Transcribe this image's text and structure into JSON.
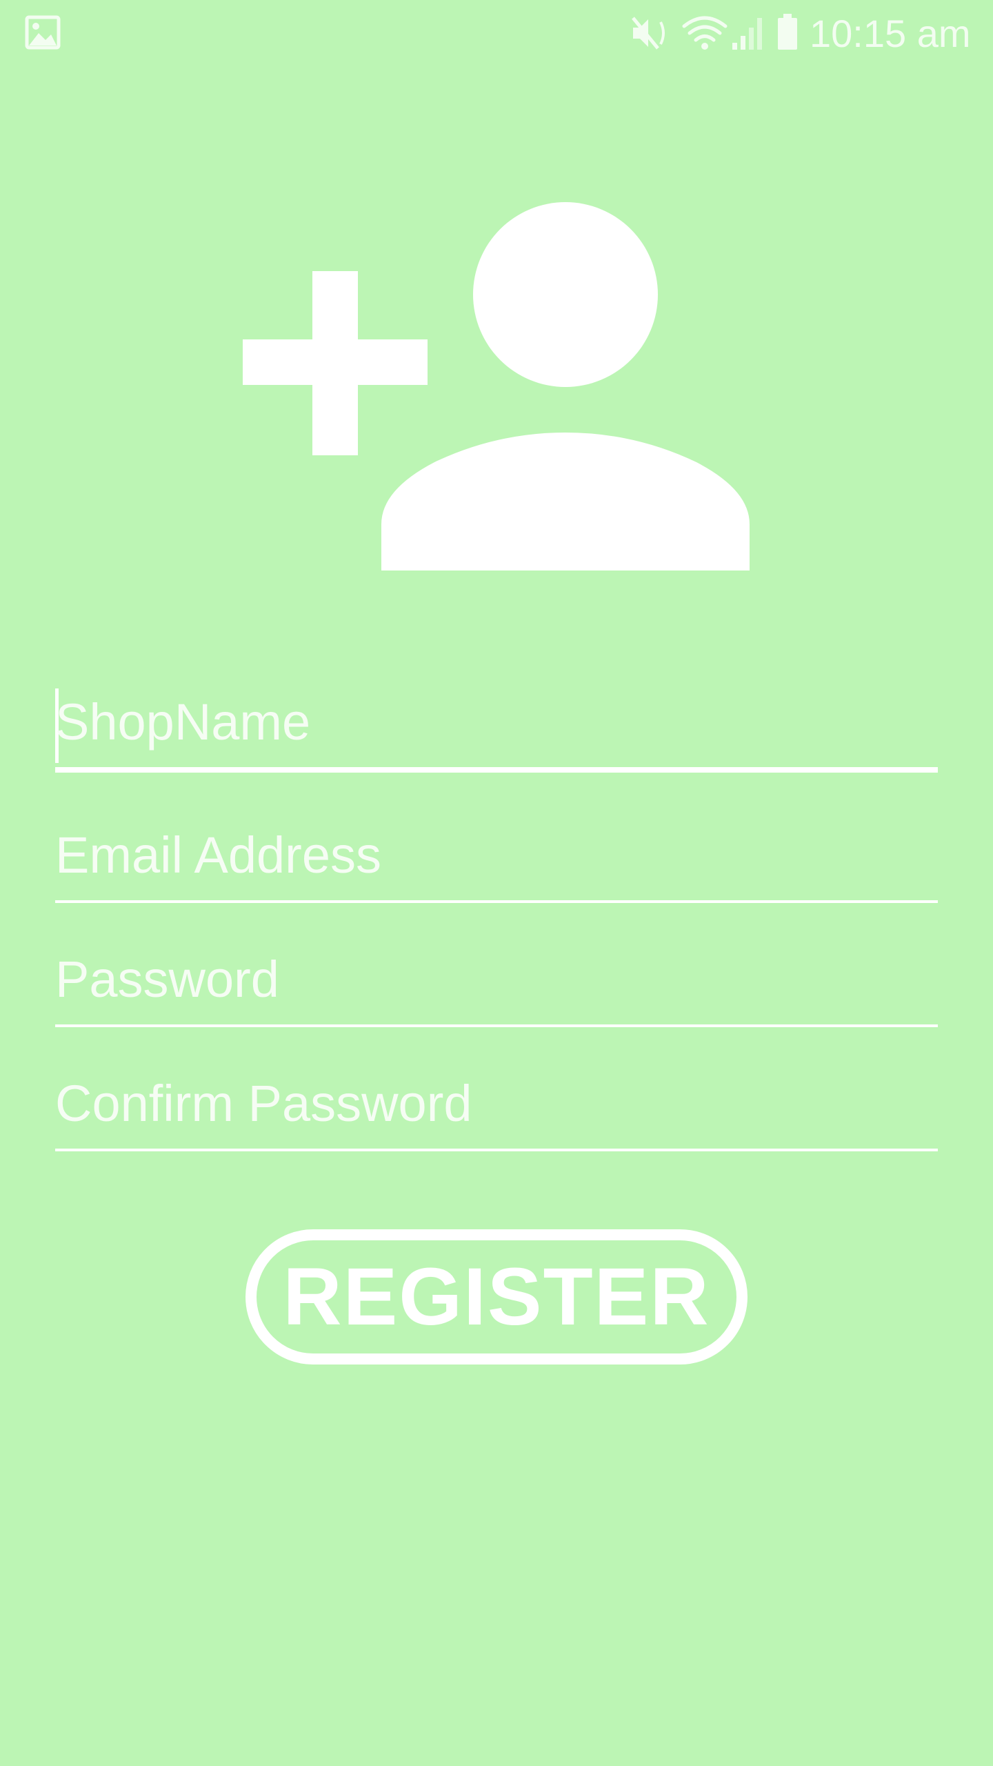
{
  "status_bar": {
    "time": "10:15 am",
    "icons": [
      "gallery-icon",
      "mute-icon",
      "wifi-icon",
      "signal-icon",
      "battery-icon"
    ]
  },
  "hero": {
    "icon": "add-user-icon"
  },
  "form": {
    "shop_name": {
      "placeholder": "ShopName",
      "value": ""
    },
    "email": {
      "placeholder": "Email Address",
      "value": ""
    },
    "password": {
      "placeholder": "Password",
      "value": ""
    },
    "confirm_password": {
      "placeholder": "Confirm Password",
      "value": ""
    }
  },
  "register_button": {
    "label": "REGISTER"
  },
  "colors": {
    "background": "#bcf5b4",
    "foreground": "#ffffff"
  }
}
